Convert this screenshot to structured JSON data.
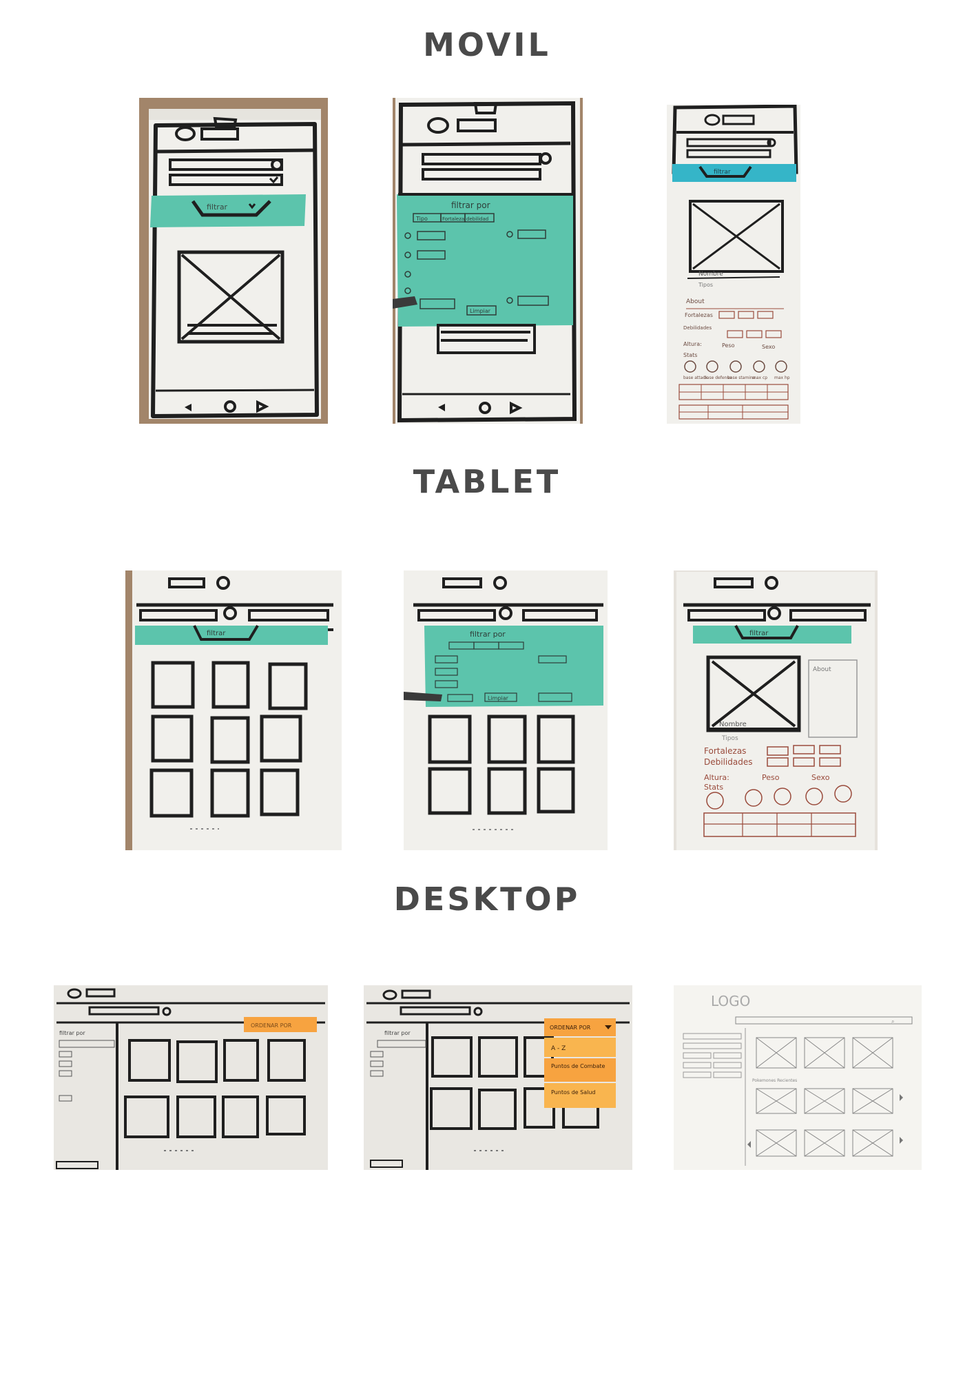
{
  "sections": {
    "movil": "MOVIL",
    "tablet": "TABLET",
    "desktop": "DESKTOP"
  },
  "colors": {
    "teal_paper": "#5cc4ac",
    "orange_paper": "#f7a340",
    "wood": "#a2856a",
    "ink": "#1f1f1f",
    "red_ink": "#9a4b3c",
    "title": "#4a4a4a"
  },
  "sketch_text": {
    "filtrar": "filtrar",
    "filtrar_por": "filtrar por",
    "tabs": [
      "Tipo",
      "Fortaleza",
      "debilidad"
    ],
    "limpiar": "Limpiar",
    "nombre": "Nombre",
    "tipos": "Tipos",
    "about": "About",
    "fortalezas": "Fortalezas",
    "debilidades": "Debilidades",
    "altura": "Altura:",
    "peso": "Peso",
    "sexo": "Sexo",
    "stats": "Stats",
    "stat_names": [
      "base attack",
      "base defense",
      "base stamina",
      "max cp",
      "max hp"
    ],
    "ordenar_por": "ORDENAR POR",
    "orden_options": [
      "A - Z",
      "Puntos de Combate",
      "Puntos de Salud"
    ],
    "logo": "LOGO",
    "pokemones_recientes": "Pokemones Recientes"
  }
}
